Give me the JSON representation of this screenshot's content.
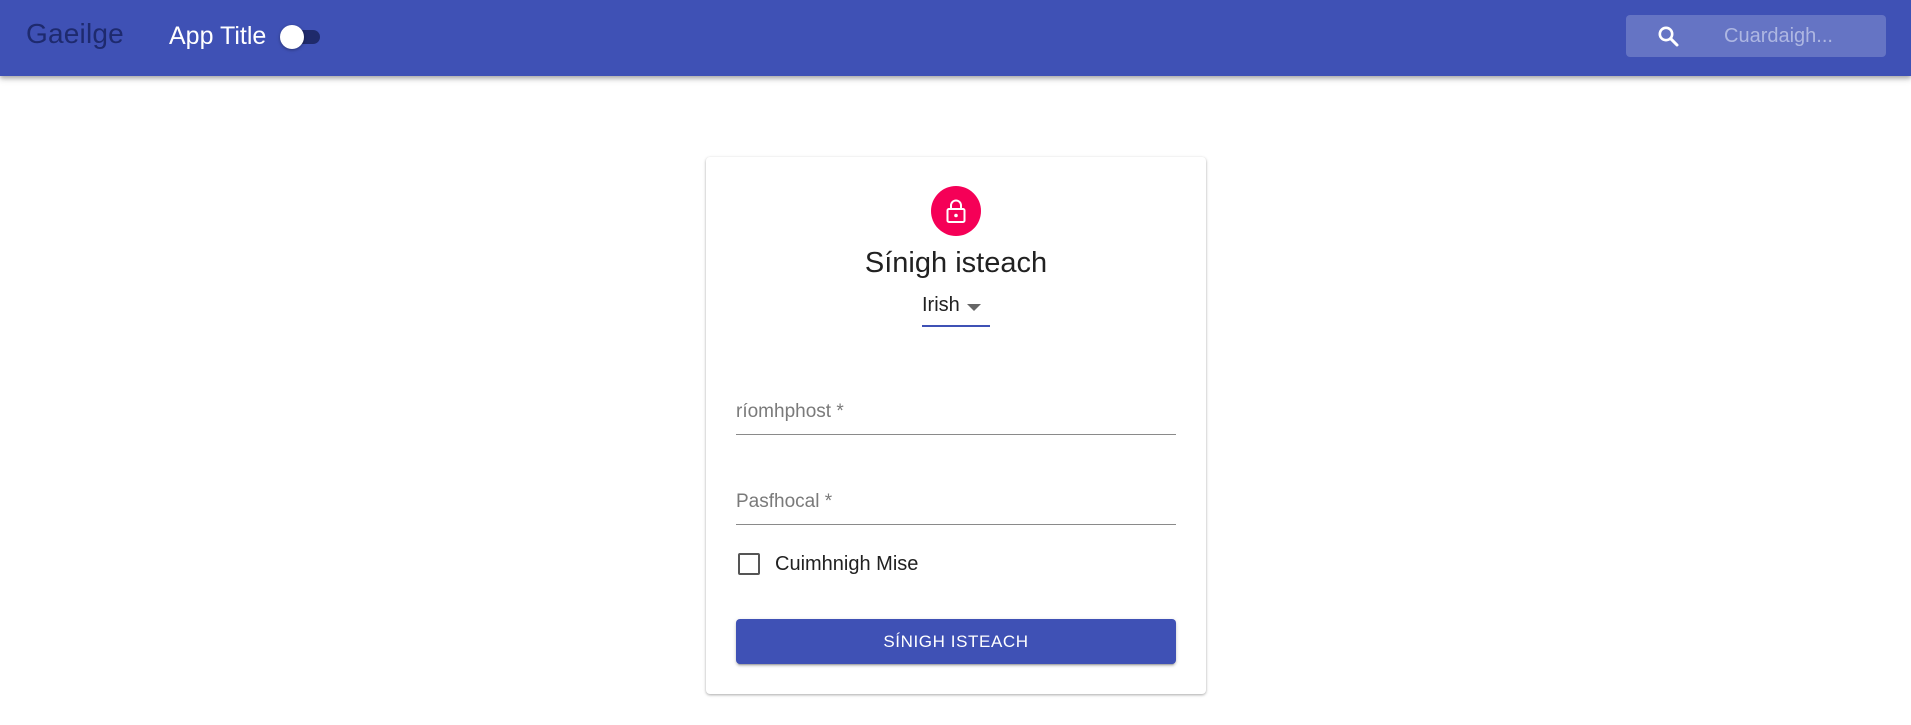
{
  "header": {
    "brand": "Gaeilge",
    "app_title": "App Title",
    "theme_toggle": {
      "on": false
    },
    "search": {
      "placeholder": "Cuardaigh...",
      "value": "",
      "icon": "search-icon"
    }
  },
  "login": {
    "icon": "lock-icon",
    "heading": "Sínigh isteach",
    "language": {
      "selected": "Irish"
    },
    "email_label": "ríomhphost *",
    "password_label": "Pasfhocal *",
    "remember_label": "Cuimhnigh Mise",
    "remember_checked": false,
    "submit_label": "SÍNIGH ISTEACH"
  },
  "colors": {
    "primary": "#3f51b5",
    "secondary": "#f50057",
    "brand_text": "#1e2a6e",
    "search_bg": "#6574c4"
  }
}
